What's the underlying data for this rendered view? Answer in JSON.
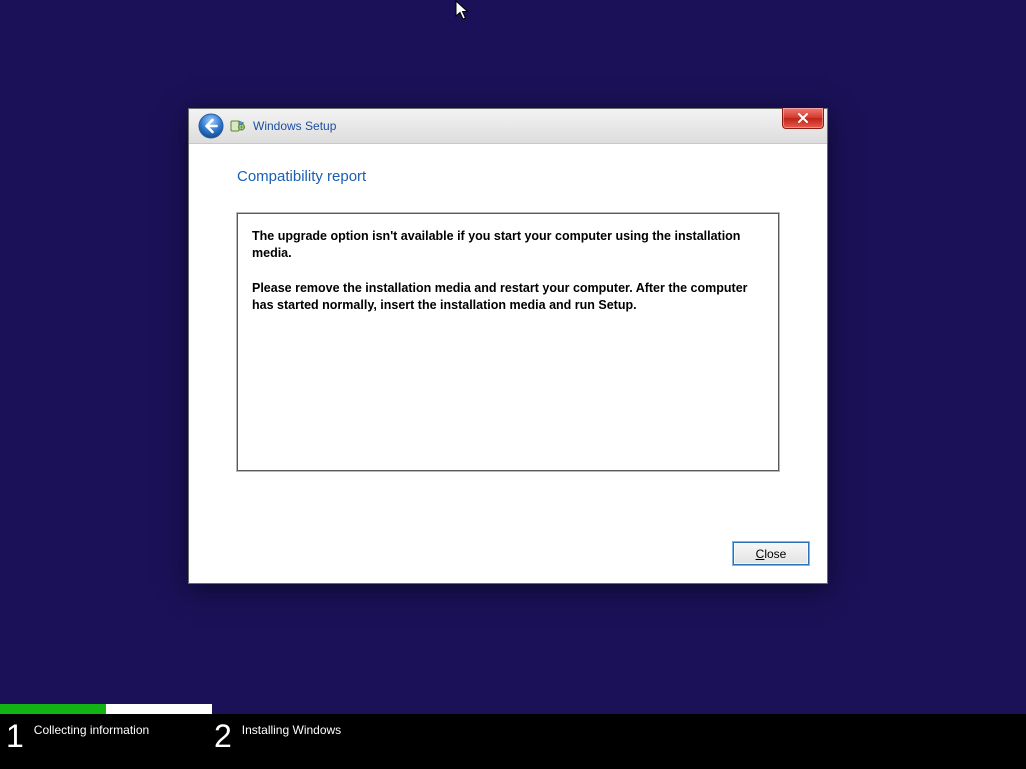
{
  "titlebar": {
    "title": "Windows Setup"
  },
  "dialog": {
    "heading": "Compatibility report",
    "paragraph1": "The upgrade option isn't available if you start your computer using the installation media.",
    "paragraph2": "Please remove the installation media and restart your computer. After the computer has started normally, insert the installation media and run Setup.",
    "close_label": "Close"
  },
  "steps": {
    "s1_num": "1",
    "s1_label": "Collecting information",
    "s2_num": "2",
    "s2_label": "Installing Windows"
  }
}
